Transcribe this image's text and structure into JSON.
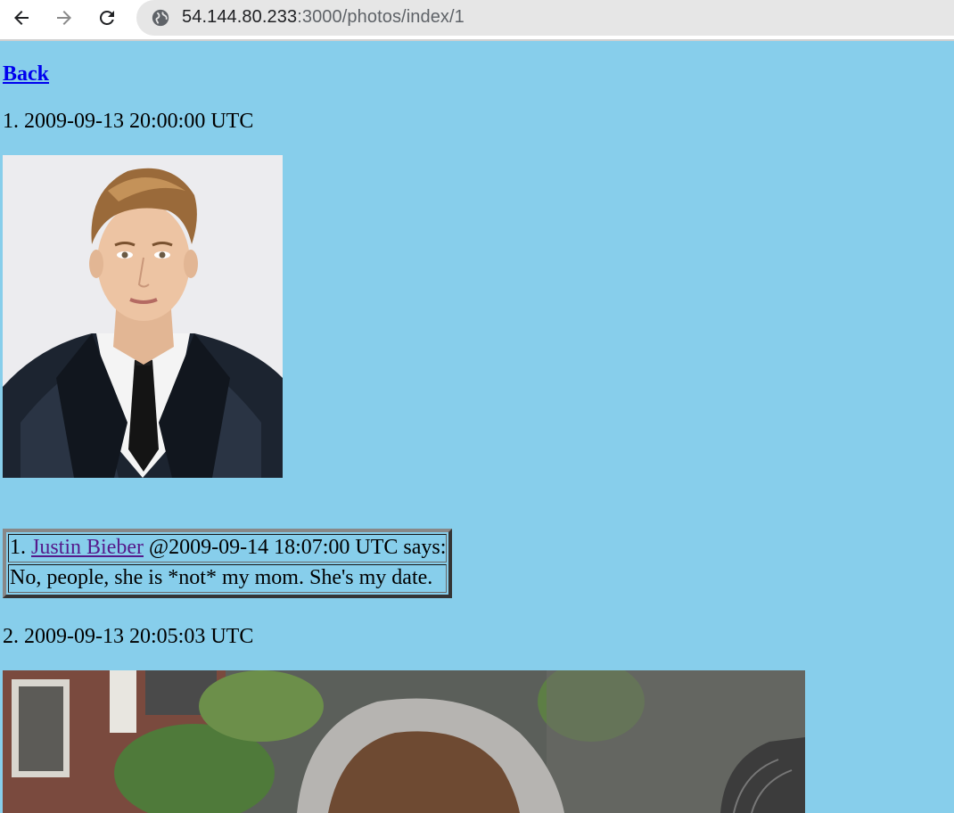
{
  "browser": {
    "url_host": "54.144.80.233",
    "url_path": ":3000/photos/index/1",
    "back_icon": "arrow-left-icon",
    "forward_icon": "arrow-right-icon",
    "reload_icon": "reload-icon",
    "site_icon": "globe-icon"
  },
  "page": {
    "back_label": "Back",
    "photos": [
      {
        "heading": "1. 2009-09-13 20:00:00 UTC",
        "comments": [
          {
            "prefix": "1.",
            "author": "Justin Bieber",
            "meta": "@2009-09-14 18:07:00 UTC says:",
            "body": "No, people, she is *not* my mom. She's my date."
          }
        ]
      },
      {
        "heading": "2. 2009-09-13 20:05:03 UTC",
        "comments": []
      }
    ]
  },
  "colors": {
    "page_background": "#87ceeb",
    "link": "#0000ee",
    "visited_link": "#551a8b"
  }
}
